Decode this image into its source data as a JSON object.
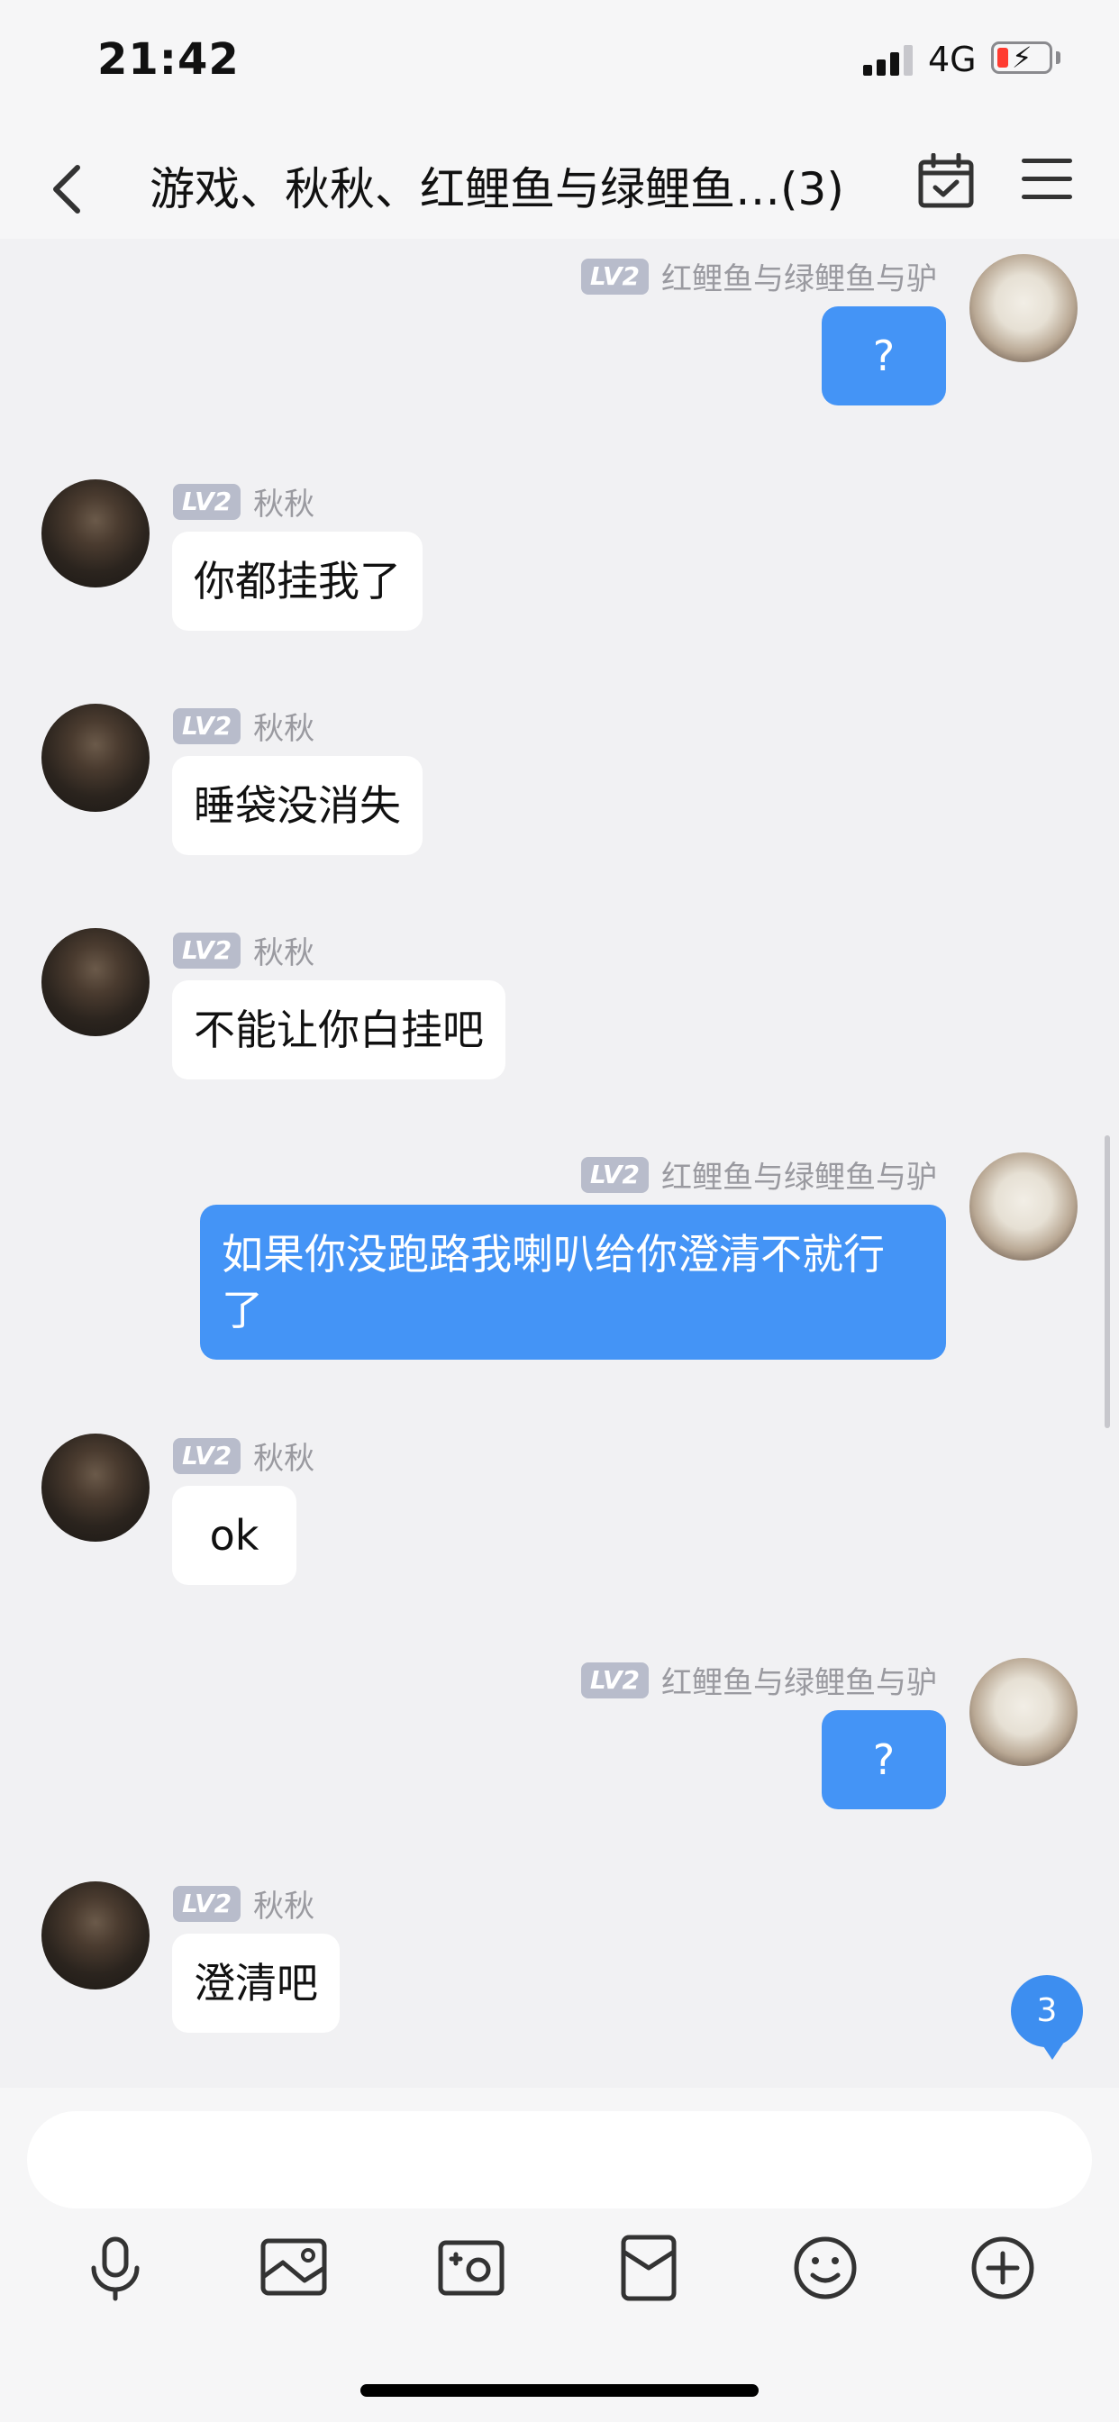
{
  "status_bar": {
    "time": "21:42",
    "network": "4G"
  },
  "header": {
    "title": "游戏、秋秋、红鲤鱼与绿鲤鱼…(3)"
  },
  "messages": [
    {
      "side": "right",
      "level": "LV2",
      "sender": "红鲤鱼与绿鲤鱼与驴",
      "text": "?"
    },
    {
      "side": "left",
      "level": "LV2",
      "sender": "秋秋",
      "text": "你都挂我了"
    },
    {
      "side": "left",
      "level": "LV2",
      "sender": "秋秋",
      "text": "睡袋没消失"
    },
    {
      "side": "left",
      "level": "LV2",
      "sender": "秋秋",
      "text": "不能让你白挂吧"
    },
    {
      "side": "right",
      "level": "LV2",
      "sender": "红鲤鱼与绿鲤鱼与驴",
      "text": "如果你没跑路我喇叭给你澄清不就行了"
    },
    {
      "side": "left",
      "level": "LV2",
      "sender": "秋秋",
      "text": "ok"
    },
    {
      "side": "right",
      "level": "LV2",
      "sender": "红鲤鱼与绿鲤鱼与驴",
      "text": "?"
    },
    {
      "side": "left",
      "level": "LV2",
      "sender": "秋秋",
      "text": "澄清吧"
    }
  ],
  "unread_badge": "3",
  "toolbar": {
    "items": [
      "mic-icon",
      "image-icon",
      "camera-icon",
      "red-packet-icon",
      "emoji-icon",
      "plus-icon"
    ]
  },
  "colors": {
    "bubble_out": "#4494f6",
    "bubble_in": "#ffffff",
    "background": "#f1f1f3",
    "badge": "#3d8ef0"
  }
}
